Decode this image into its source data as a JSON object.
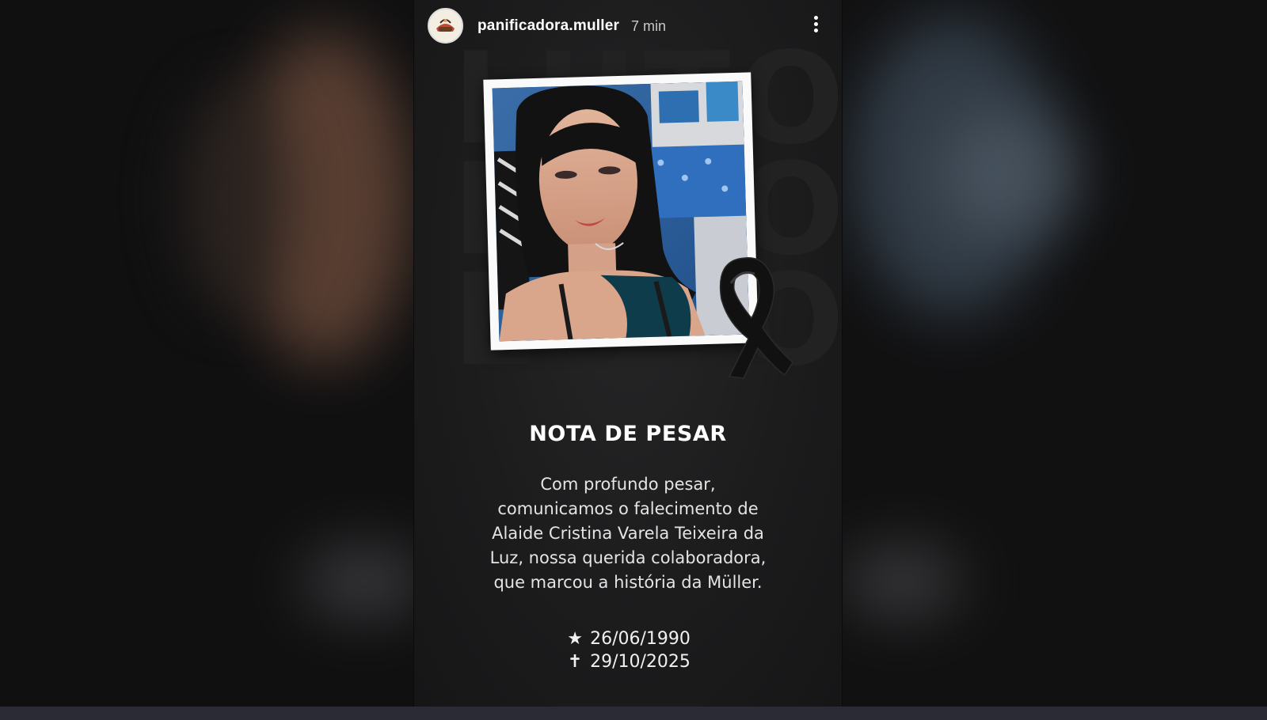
{
  "story": {
    "username": "panificadora.muller",
    "timestamp": "7 min",
    "watermark_word": "LUTO",
    "title": "NOTA DE PESAR",
    "message_lines": [
      "Com profundo pesar,",
      "comunicamos o falecimento de",
      "Alaide Cristina Varela Teixeira da",
      "Luz, nossa querida colaboradora,",
      "que marcou a história da Müller."
    ],
    "birth": {
      "icon": "star-icon",
      "glyph": "★",
      "date": "26/06/1990"
    },
    "death": {
      "icon": "cross-icon",
      "glyph": "✝",
      "date": "29/10/2025"
    },
    "menu_icon": "more-vertical-icon",
    "ribbon_icon": "mourning-ribbon-icon"
  },
  "colors": {
    "story_background": "#1c1c1d",
    "text": "#ffffff",
    "frame": "#fafafa"
  }
}
